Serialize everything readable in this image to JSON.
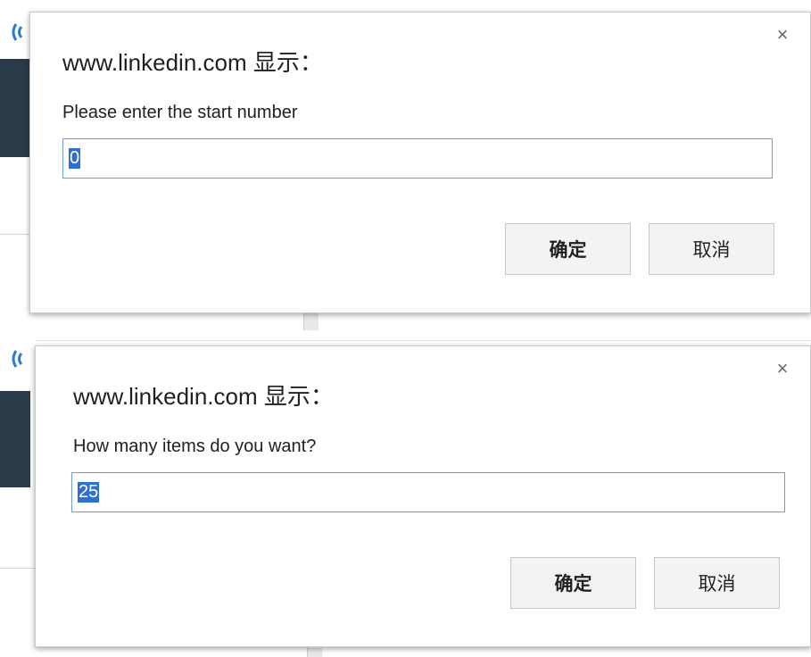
{
  "dialogs": [
    {
      "title": "www.linkedin.com 显示：",
      "prompt": "Please enter the start number",
      "input_value": "0",
      "ok_label": "确定",
      "cancel_label": "取消",
      "close_glyph": "×"
    },
    {
      "title": "www.linkedin.com 显示：",
      "prompt": "How many items do you want?",
      "input_value": "25",
      "ok_label": "确定",
      "cancel_label": "取消",
      "close_glyph": "×"
    }
  ],
  "colors": {
    "selection": "#2e6fd2",
    "input_border": "#6b9bd9",
    "dark_sidebar": "#2b3a48"
  },
  "icons": [
    "linkedin-wave-logo-icon",
    "close-icon"
  ]
}
